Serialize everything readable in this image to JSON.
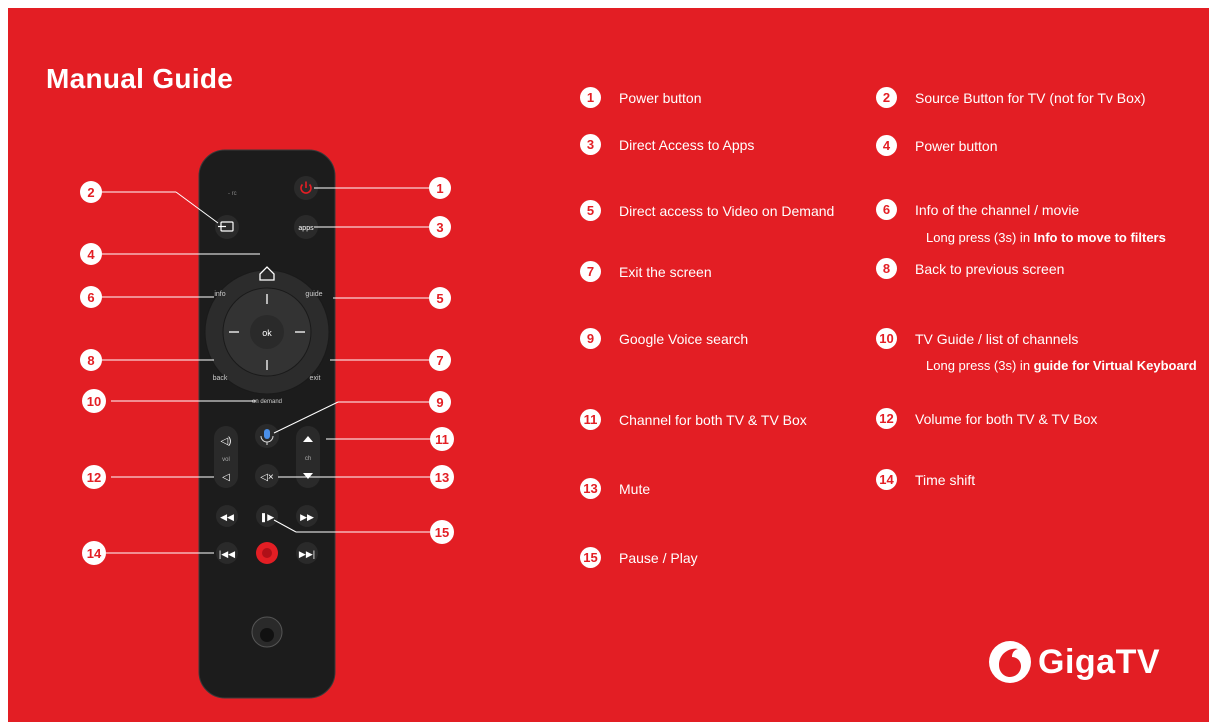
{
  "title": "Manual Guide",
  "items": [
    {
      "number": "1",
      "label": "Power button"
    },
    {
      "number": "2",
      "label": "Source Button for TV (not for Tv Box)"
    },
    {
      "number": "3",
      "label": "Direct Access to Apps"
    },
    {
      "number": "4",
      "label": "Power button"
    },
    {
      "number": "5",
      "label": "Direct access to Video on Demand"
    },
    {
      "number": "6",
      "label": "Info of the channel / movie"
    },
    {
      "number": "7",
      "label": "Exit the screen"
    },
    {
      "number": "8",
      "label": "Back to previous screen"
    },
    {
      "number": "9",
      "label": "Google Voice search"
    },
    {
      "number": "10",
      "label": "TV Guide / list of channels"
    },
    {
      "number": "11",
      "label": "Channel for both TV & TV Box"
    },
    {
      "number": "12",
      "label": "Volume for both TV & TV Box"
    },
    {
      "number": "13",
      "label": "Mute"
    },
    {
      "number": "14",
      "label": "Time shift"
    },
    {
      "number": "15",
      "label": "Pause / Play"
    }
  ],
  "notes": {
    "info": {
      "prefix": "Long press (3s) in ",
      "bold": "Info",
      "suffix": " to move to filters"
    },
    "guide": {
      "prefix": "Long press (3s) in ",
      "bold": "guide",
      "suffix": " for Virtual Keyboard"
    }
  },
  "remote": {
    "buttons": {
      "apps": "apps",
      "info": "info",
      "guide": "guide",
      "ok": "ok",
      "back": "back",
      "exit": "exit",
      "on_demand": "on demand",
      "vol": "vol",
      "ch": "ch"
    }
  },
  "logo": {
    "text": "GigaTV"
  },
  "colors": {
    "background": "#e31e24",
    "remote_body": "#1c1c1c",
    "power_accent": "#e31e24"
  }
}
